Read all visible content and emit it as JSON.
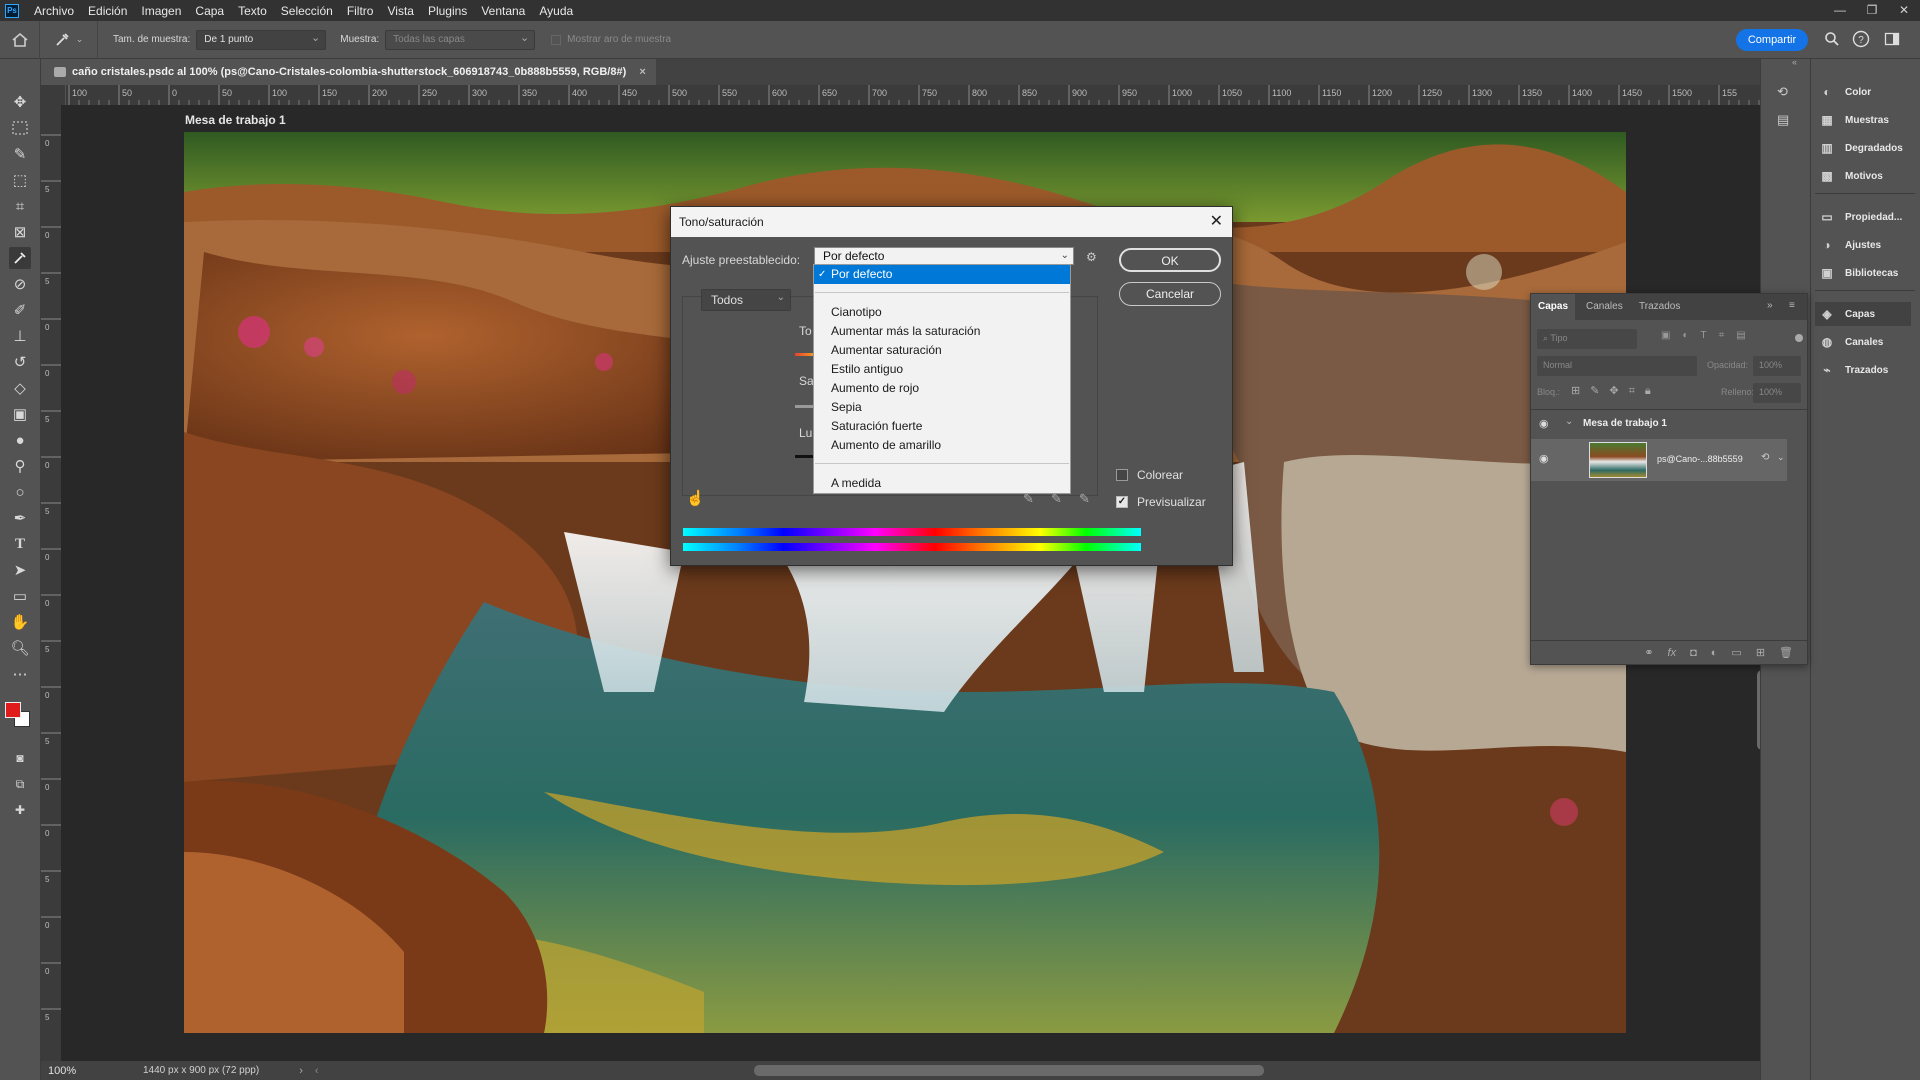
{
  "menubar": {
    "items": [
      "Archivo",
      "Edición",
      "Imagen",
      "Capa",
      "Texto",
      "Selección",
      "Filtro",
      "Vista",
      "Plugins",
      "Ventana",
      "Ayuda"
    ]
  },
  "options_bar": {
    "sample_size_label": "Tam. de muestra:",
    "sample_size_value": "De 1 punto",
    "sample_label": "Muestra:",
    "sample_value": "Todas las capas",
    "show_ring_label": "Mostrar aro de muestra",
    "share_label": "Compartir"
  },
  "document": {
    "tab_title": "caño cristales.psdc al 100% (ps@Cano-Cristales-colombia-shutterstock_606918743_0b888b5559, RGB/8#)",
    "artboard_label": "Mesa de trabajo 1",
    "zoom": "100%",
    "dimensions": "1440 px x 900 px (72 ppp)"
  },
  "ruler": {
    "top_ticks": [
      "100",
      "50",
      "0",
      "50",
      "100",
      "150",
      "200",
      "250",
      "300",
      "350",
      "400",
      "450",
      "500",
      "550",
      "600",
      "650",
      "700",
      "750",
      "800",
      "850",
      "900",
      "950",
      "1000",
      "1050",
      "1100",
      "1150",
      "1200",
      "1250",
      "1300",
      "1350",
      "1400",
      "1450",
      "1500",
      "155"
    ],
    "left_ticks": [
      "0",
      "5",
      "0",
      "5",
      "0",
      "0",
      "5",
      "0",
      "5",
      "0",
      "0",
      "5",
      "0",
      "5",
      "0",
      "0",
      "5",
      "0",
      "0",
      "5"
    ]
  },
  "dialog": {
    "title": "Tono/saturación",
    "preset_label": "Ajuste preestablecido:",
    "preset_value": "Por defecto",
    "channel_value": "Todos",
    "hue_label_partial": "To",
    "sat_label_partial": "Sa",
    "light_label_partial": "Lu",
    "ok_label": "OK",
    "cancel_label": "Cancelar",
    "colorize_label": "Colorear",
    "colorize_checked": false,
    "preview_label": "Previsualizar",
    "preview_checked": true
  },
  "preset_menu": {
    "selected": "Por defecto",
    "group1": [
      "Cianotipo",
      "Aumentar más la saturación",
      "Aumentar saturación",
      "Estilo antiguo",
      "Aumento de rojo",
      "Sepia",
      "Saturación fuerte",
      "Aumento de amarillo"
    ],
    "custom": "A medida"
  },
  "right_panels": {
    "group1": [
      "Color",
      "Muestras",
      "Degradados",
      "Motivos"
    ],
    "group2": [
      "Propiedad...",
      "Ajustes",
      "Bibliotecas"
    ],
    "group3": [
      "Capas",
      "Canales",
      "Trazados"
    ]
  },
  "layers_panel": {
    "tabs": [
      "Capas",
      "Canales",
      "Trazados"
    ],
    "filter_placeholder": "Tipo",
    "blend_mode": "Normal",
    "opacity_label": "Opacidad:",
    "opacity_value": "100%",
    "lock_label": "Bloq.:",
    "fill_label": "Relleno:",
    "fill_value": "100%",
    "artboard_name": "Mesa de trabajo 1",
    "layer_name": "ps@Cano-...88b5559"
  },
  "colors": {
    "accent": "#1473e6",
    "foreground": "#e01b1b",
    "background": "#ffffff",
    "menu_highlight": "#0078d7"
  }
}
